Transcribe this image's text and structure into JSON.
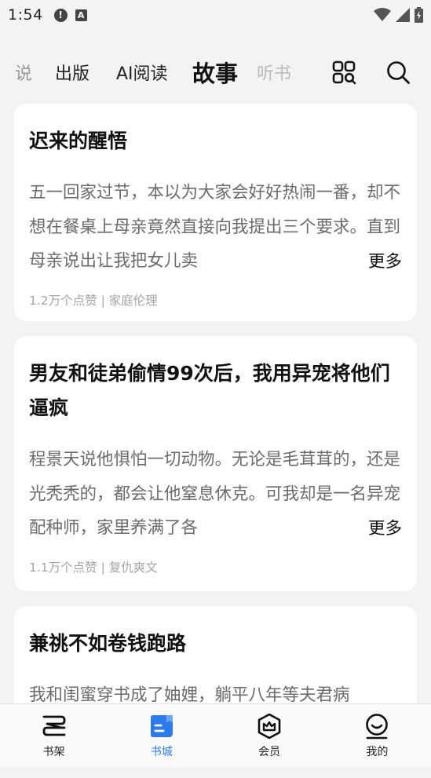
{
  "status": {
    "time": "1:54",
    "alert_glyph": "!",
    "a_glyph": "A"
  },
  "tabs": [
    {
      "label": "说"
    },
    {
      "label": "出版"
    },
    {
      "label": "AI阅读"
    },
    {
      "label": "故事"
    },
    {
      "label": "听书"
    }
  ],
  "icons": {
    "apps": "apps-grid-icon",
    "search": "search-icon"
  },
  "cards": [
    {
      "title": "迟来的醒悟",
      "excerpt": "五一回家过节，本以为大家会好好热闹一番，却不想在餐桌上母亲竟然直接向我提出三个要求。直到母亲说出让我把女儿卖",
      "more": "更多",
      "meta": "1.2万个点赞 | 家庭伦理"
    },
    {
      "title": "男友和徒弟偷情99次后，我用异宠将他们逼疯",
      "excerpt": "程景天说他惧怕一切动物。无论是毛茸茸的，还是光秃秃的，都会让他窒息休克。可我却是一名异宠配种师，家里养满了各",
      "more": "更多",
      "meta": "1.1万个点赞 | 复仇爽文"
    },
    {
      "title": "兼祧不如卷钱跑路",
      "excerpt": "我和闺蜜穿书成了妯娌，躺平八年等夫君病"
    }
  ],
  "nav": [
    {
      "label": "书架"
    },
    {
      "label": "书城"
    },
    {
      "label": "会员"
    },
    {
      "label": "我的"
    }
  ],
  "colors": {
    "accent": "#2b7bf0",
    "background": "#f3f3f5",
    "card": "#ffffff"
  }
}
